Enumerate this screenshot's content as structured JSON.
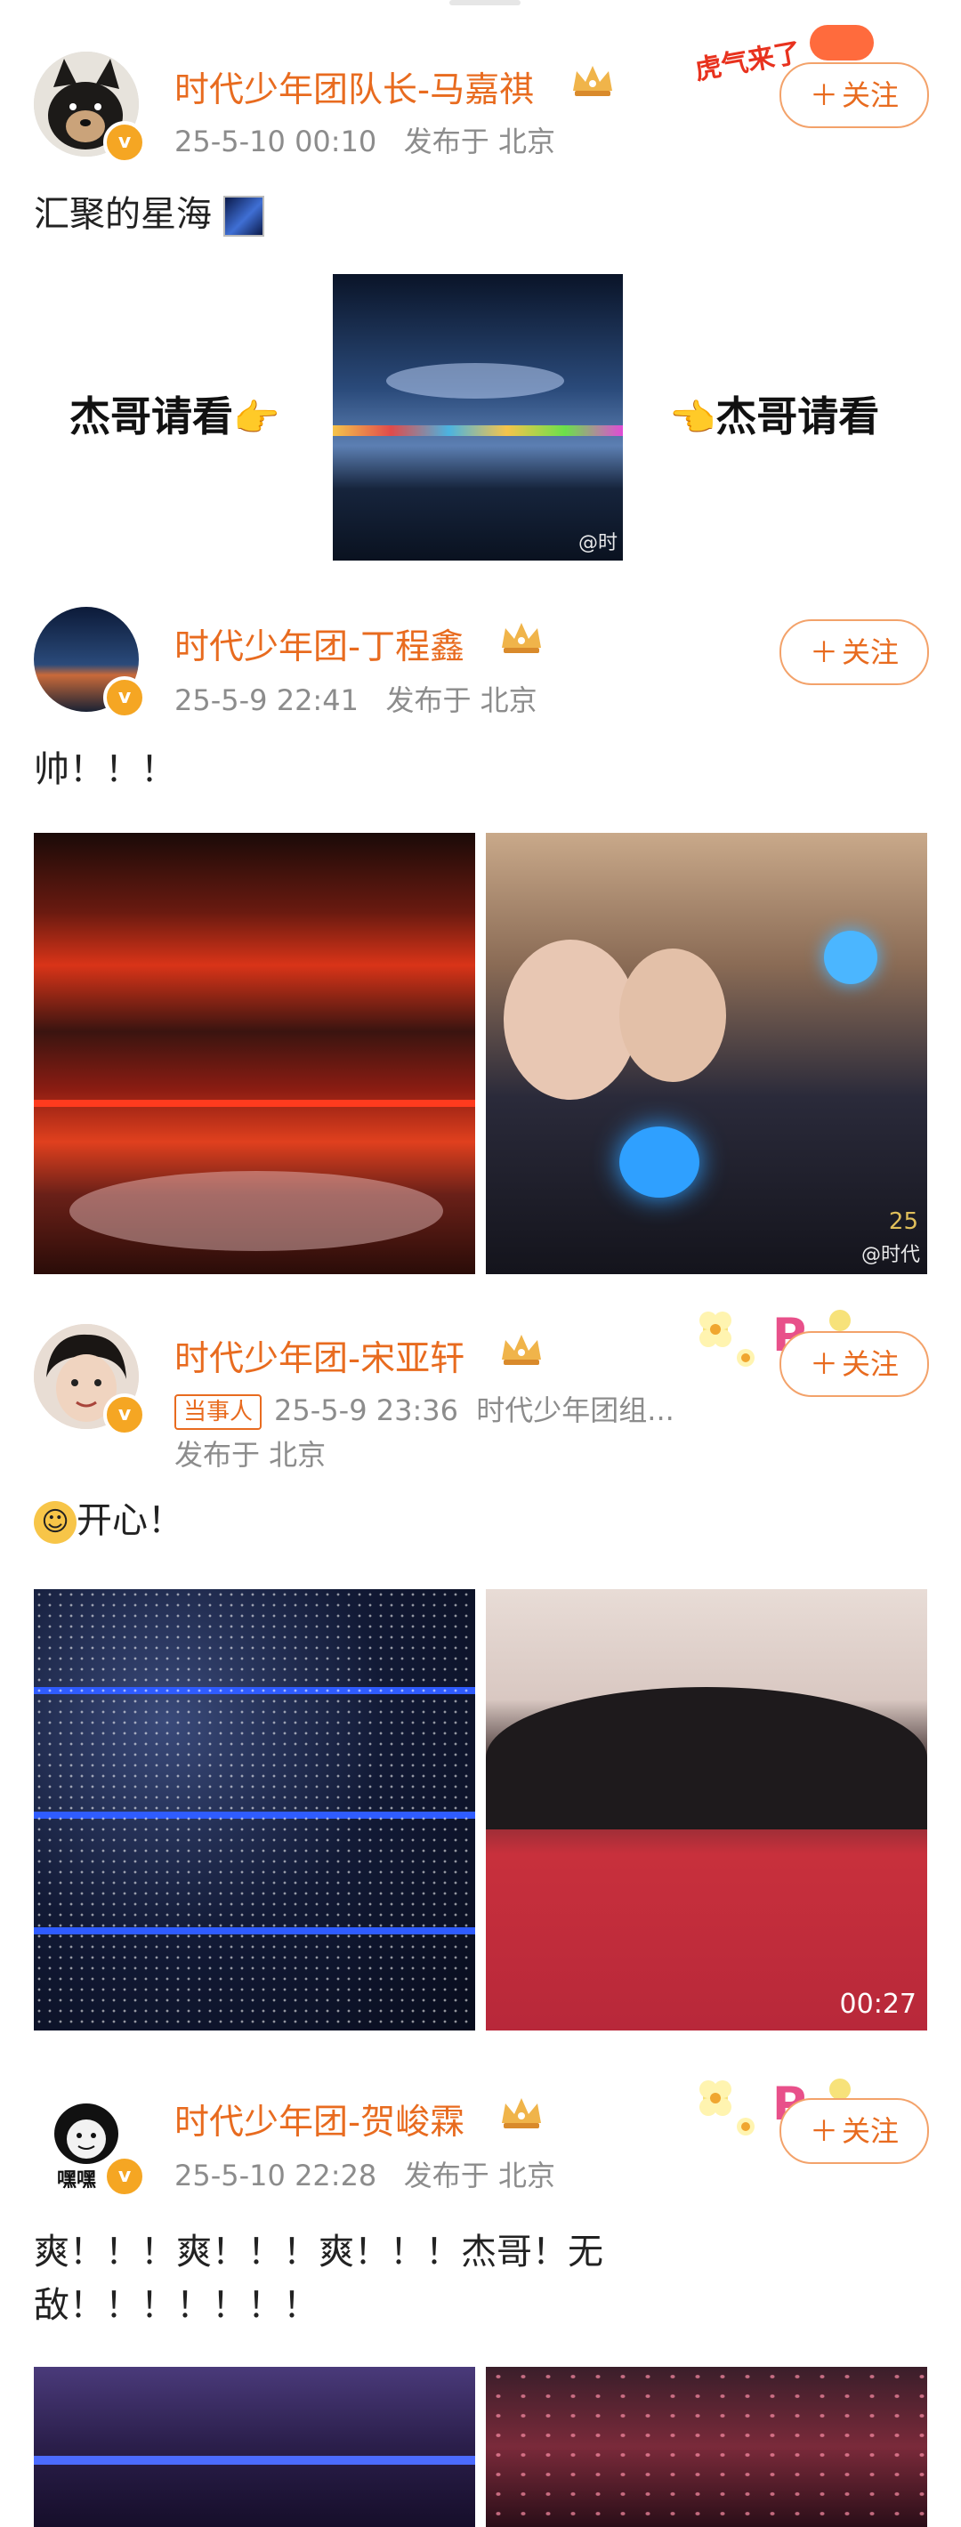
{
  "posts": [
    {
      "name": "时代少年团队长-马嘉祺",
      "time": "25-5-10 00:10",
      "location": "发布于 北京",
      "follow": "关注",
      "text": "汇聚的星海",
      "image_side_left": "杰哥请看",
      "image_side_right": "杰哥请看",
      "watermark": "@时",
      "sticker_text": "虎气来了"
    },
    {
      "name": "时代少年团-丁程鑫",
      "time": "25-5-9 22:41",
      "location": "发布于 北京",
      "follow": "关注",
      "text": "帅！！！",
      "watermark": "@时代",
      "image_number": "25"
    },
    {
      "name": "时代少年团-宋亚轩",
      "badge": "当事人",
      "time": "25-5-9 23:36",
      "source": "时代少年团组...",
      "location": "发布于 北京",
      "follow": "关注",
      "text": "开心！",
      "video_duration": "00:27"
    },
    {
      "name": "时代少年团-贺峻霖",
      "avatar_caption": "嘿嘿",
      "time": "25-5-10 22:28",
      "location": "发布于 北京",
      "follow": "关注",
      "text_line1": "爽！！！爽！！！爽！！！杰哥！无",
      "text_line2": "敌！！！！！！！"
    }
  ]
}
